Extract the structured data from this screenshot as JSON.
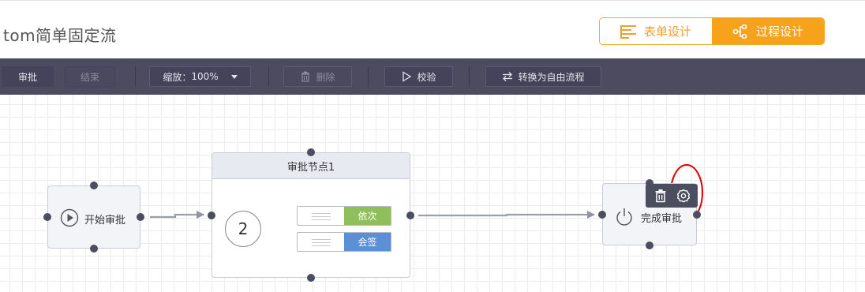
{
  "header": {
    "title": "tom简单固定流",
    "tabs": [
      {
        "label": "表单设计",
        "icon": "form-lines-icon",
        "active": false
      },
      {
        "label": "过程设计",
        "icon": "flow-tree-icon",
        "active": true
      }
    ],
    "accent_color": "#f7a21b"
  },
  "toolbar": {
    "approve_label": "审批",
    "end_label": "结束",
    "zoom_label": "缩放：",
    "zoom_value": "100%",
    "delete_label": "删除",
    "validate_label": "校验",
    "convert_label": "转换为自由流程"
  },
  "nodes": {
    "start": {
      "label": "开始审批",
      "icon": "play-circle-icon"
    },
    "approve": {
      "title": "审批节点1",
      "count": "2",
      "modes": [
        {
          "label": "依次",
          "color": "#8fbf5a"
        },
        {
          "label": "会签",
          "color": "#5b8fd6"
        }
      ]
    },
    "end": {
      "label": "完成审批",
      "icon": "power-icon"
    }
  },
  "popup": {
    "actions": [
      "trash-icon",
      "gear-icon"
    ]
  },
  "annotation": {
    "color": "#e00000"
  }
}
